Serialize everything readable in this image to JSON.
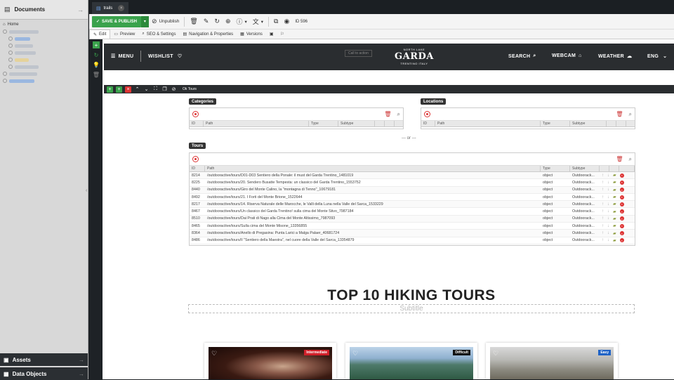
{
  "left": {
    "documents_label": "Documents",
    "home_label": "Home",
    "assets_label": "Assets",
    "data_objects_label": "Data Objects"
  },
  "tab": {
    "label": "trails"
  },
  "toolbar": {
    "save_label": "SAVE & PUBLISH",
    "unpublish_label": "Unpublish",
    "id_label": "ID 596"
  },
  "subtabs": [
    {
      "label": "Edit"
    },
    {
      "label": "Preview"
    },
    {
      "label": "SEO & Settings"
    },
    {
      "label": "Navigation & Properties"
    },
    {
      "label": "Versions"
    }
  ],
  "site": {
    "menu": "MENU",
    "wishlist": "WISHLIST",
    "logo_small_top": "NORTH LAKE",
    "logo": "GARDA",
    "logo_small_bottom": "TRENTINO ITALY",
    "search": "SEARCH",
    "webcam": "WEBCAM",
    "weather": "WEATHER",
    "lang": "ENG",
    "ghost": "Call to action"
  },
  "tours_bar": {
    "label": "Ok Tours"
  },
  "categories": {
    "title": "Categories",
    "columns": [
      "ID",
      "Path",
      "Type",
      "Subtype"
    ]
  },
  "locations": {
    "title": "Locations",
    "columns": [
      "ID",
      "Path",
      "Type",
      "Subtype"
    ]
  },
  "or_label": "--- or ---",
  "tours": {
    "title": "Tours",
    "columns": [
      "ID",
      "Path",
      "Type",
      "Subtype"
    ],
    "rows": [
      {
        "id": "8214",
        "path": "/outdooractive/tours/D01-D03 Sentiero della Ponale: il must del Garda Trentino_1481019",
        "type": "object",
        "subtype": "Outdoorack..."
      },
      {
        "id": "8225",
        "path": "/outdooractive/tours/20. Sendero Busatte Tempesta: un classico del Garda Trentino_1553752",
        "type": "object",
        "subtype": "Outdoorack..."
      },
      {
        "id": "8440",
        "path": "/outdooractive/tours/Giro del Monte Calino, la \"montagna di Tenno\"_10679181",
        "type": "object",
        "subtype": "Outdoorack..."
      },
      {
        "id": "8492",
        "path": "/outdooractive/tours/21. I Forti del Monte Brione_1522644",
        "type": "object",
        "subtype": "Outdoorack..."
      },
      {
        "id": "8217",
        "path": "/outdooractive/tours/14. Riserva Naturale delle Marocche, le Valli della Luna nella Valle del Sarca_1533229",
        "type": "object",
        "subtype": "Outdoorack..."
      },
      {
        "id": "8467",
        "path": "/outdooractive/tours/Un classico del Garda Trentino! sulla cima del Monte Stivo_7987184",
        "type": "object",
        "subtype": "Outdoorack..."
      },
      {
        "id": "8510",
        "path": "/outdooractive/tours/Dai Prati di Nago alla Cima del Monte Altissimo_7987093",
        "type": "object",
        "subtype": "Outdoorack..."
      },
      {
        "id": "8465",
        "path": "/outdooractive/tours/Sulla cima del Monte Misone_13356855",
        "type": "object",
        "subtype": "Outdoorack..."
      },
      {
        "id": "8364",
        "path": "/outdooractive/tours/Anello di Pregasina: Punta Larici a Malga Palaer_40681724",
        "type": "object",
        "subtype": "Outdoorack..."
      },
      {
        "id": "8486",
        "path": "/outdooractive/tours/Il \"Sentiero della Maestra\", nel cuore della Valle del Sarca_13354879",
        "type": "object",
        "subtype": "Outdoorack..."
      }
    ]
  },
  "heading": "TOP 10 HIKING TOURS",
  "subtitle": "Subtitle",
  "cards": [
    {
      "badge": "Intermediate",
      "badge_color": "#d0202a"
    },
    {
      "badge": "Difficult",
      "badge_color": "#111111"
    },
    {
      "badge": "Easy",
      "badge_color": "#1f63c6"
    }
  ]
}
